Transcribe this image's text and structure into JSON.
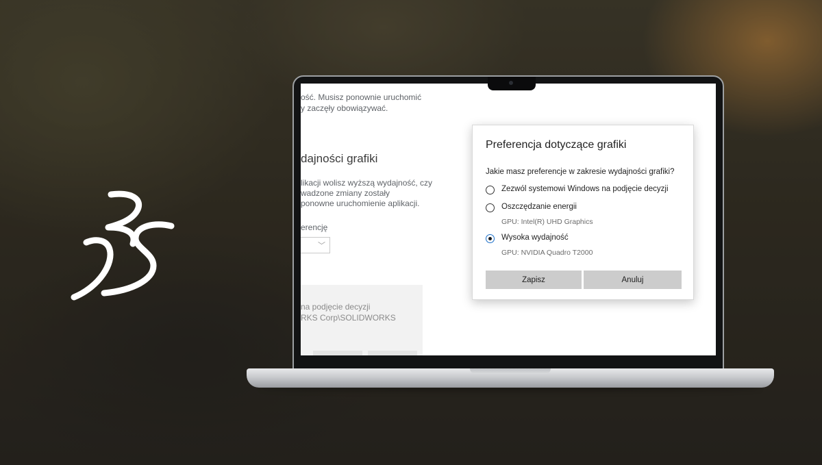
{
  "background": {
    "cropped_text_lines": [
      "ość. Musisz ponownie uruchomić",
      "y zaczęły obowiązywać."
    ],
    "cropped_heading": "dajności grafiki",
    "cropped_desc_lines": [
      "likacji wolisz wyższą wydajność, czy",
      "wadzone zmiany zostały",
      "ponowne uruchomienie aplikacji."
    ],
    "cropped_label": "erencję",
    "cropped_panel_lines": [
      "na podjęcie decyzji",
      "RKS Corp\\SOLIDWORKS"
    ]
  },
  "dialog": {
    "title": "Preferencja dotyczące grafiki",
    "question": "Jakie masz preferencje w zakresie wydajności grafiki?",
    "options": [
      {
        "label": "Zezwól systemowi Windows na podjęcie decyzji",
        "sub": "",
        "selected": false
      },
      {
        "label": "Oszczędzanie energii",
        "sub": "GPU: Intel(R) UHD Graphics",
        "selected": false
      },
      {
        "label": "Wysoka wydajność",
        "sub": "GPU: NVIDIA Quadro T2000",
        "selected": true
      }
    ],
    "save_label": "Zapisz",
    "cancel_label": "Anuluj"
  },
  "colors": {
    "accent": "#1a6fc9",
    "button_bg": "#cccccc",
    "logo": "#ffffff"
  },
  "icons": {
    "logo": "dassault-systemes-3ds-logo",
    "dropdown": "chevron-down-icon"
  }
}
